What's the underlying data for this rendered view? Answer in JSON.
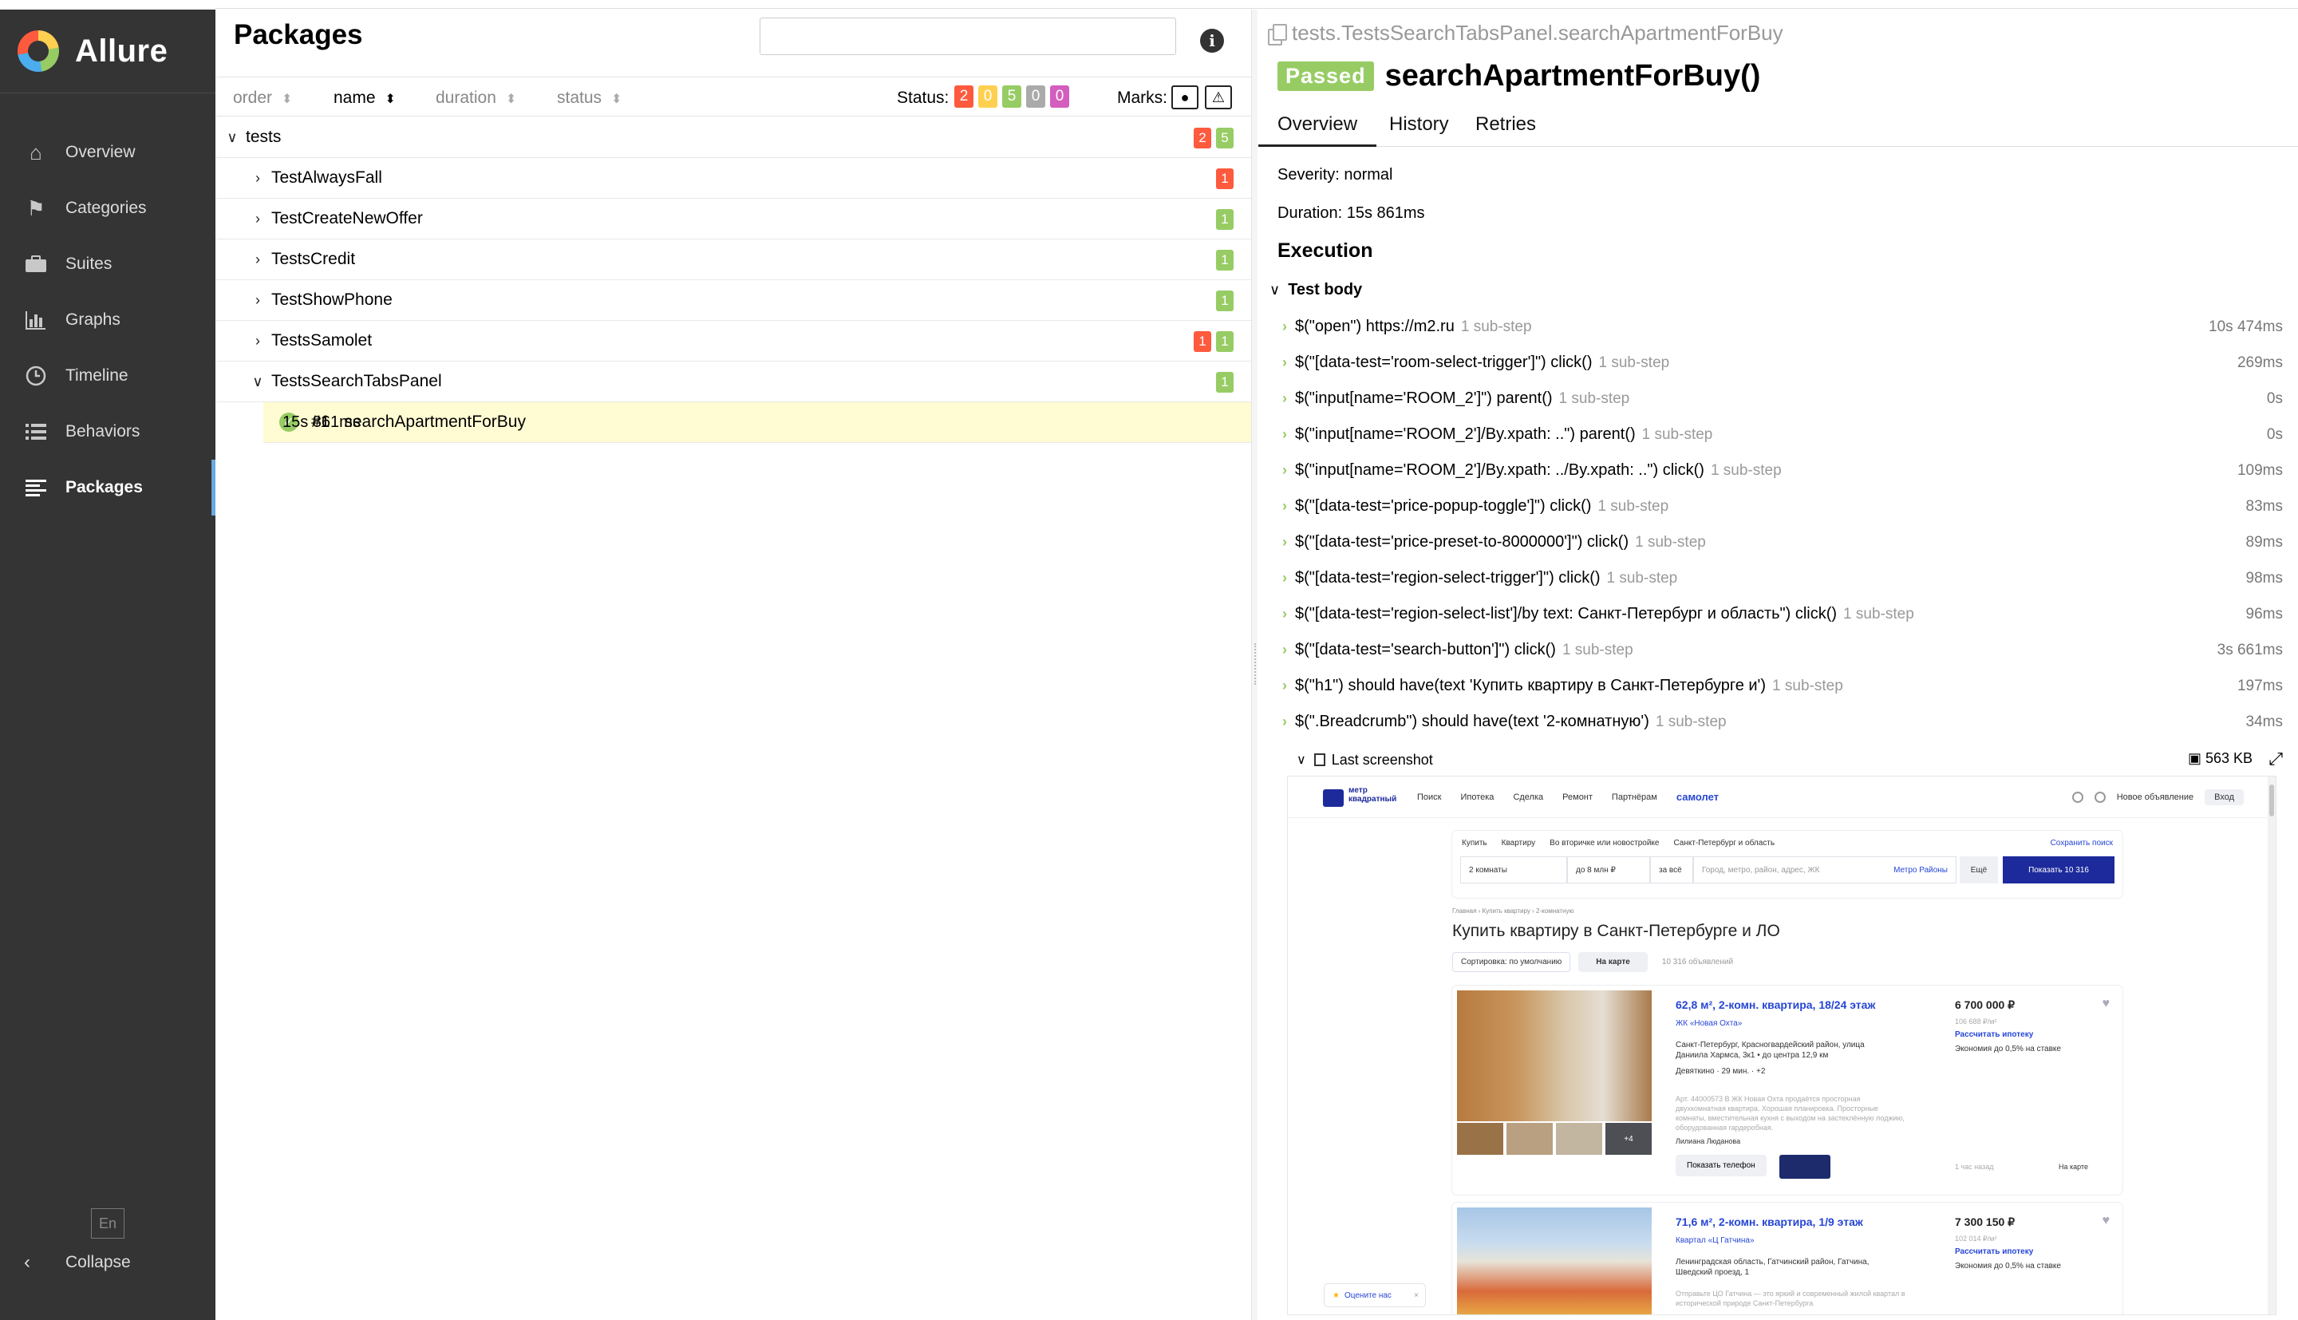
{
  "app": {
    "name": "Allure"
  },
  "sidebar": {
    "items": [
      {
        "label": "Overview",
        "icon": "home-icon"
      },
      {
        "label": "Categories",
        "icon": "flag-icon"
      },
      {
        "label": "Suites",
        "icon": "briefcase-icon"
      },
      {
        "label": "Graphs",
        "icon": "bar-chart-icon"
      },
      {
        "label": "Timeline",
        "icon": "clock-icon"
      },
      {
        "label": "Behaviors",
        "icon": "list-icon"
      },
      {
        "label": "Packages",
        "icon": "align-left-icon",
        "active": true
      }
    ],
    "language": "En",
    "collapse_label": "Collapse"
  },
  "left": {
    "title": "Packages",
    "search": {
      "value": "",
      "placeholder": ""
    },
    "sort": {
      "order": "order",
      "name": "name",
      "duration": "duration",
      "status": "status"
    },
    "status_label": "Status:",
    "status_counts": [
      "2",
      "0",
      "5",
      "0",
      "0"
    ],
    "marks_label": "Marks:",
    "tree": {
      "root": {
        "label": "tests",
        "failed": "2",
        "passed": "5"
      },
      "packages": [
        {
          "label": "TestAlwaysFall",
          "failed": "1"
        },
        {
          "label": "TestCreateNewOffer",
          "passed": "1"
        },
        {
          "label": "TestsCredit",
          "passed": "1"
        },
        {
          "label": "TestShowPhone",
          "passed": "1"
        },
        {
          "label": "TestsSamolet",
          "failed": "1",
          "passed": "1"
        },
        {
          "label": "TestsSearchTabsPanel",
          "passed": "1"
        }
      ],
      "leaf": {
        "num": "#1",
        "label": "searchApartmentForBuy",
        "duration": "15s 861ms"
      }
    }
  },
  "right": {
    "breadcrumb": "tests.TestsSearchTabsPanel.searchApartmentForBuy",
    "status": "Passed",
    "test_name": "searchApartmentForBuy()",
    "tabs": [
      "Overview",
      "History",
      "Retries"
    ],
    "severity": "Severity: normal",
    "duration": "Duration: 15s 861ms",
    "execution": "Execution",
    "test_body": "Test body",
    "steps": [
      {
        "text": "$(\"open\") https://m2.ru",
        "sub": "1 sub-step",
        "dur": "10s 474ms"
      },
      {
        "text": "$(\"[data-test='room-select-trigger']\") click()",
        "sub": "1 sub-step",
        "dur": "269ms"
      },
      {
        "text": "$(\"input[name='ROOM_2']\") parent()",
        "sub": "1 sub-step",
        "dur": "0s"
      },
      {
        "text": "$(\"input[name='ROOM_2']/By.xpath: ..\") parent()",
        "sub": "1 sub-step",
        "dur": "0s"
      },
      {
        "text": "$(\"input[name='ROOM_2']/By.xpath: ../By.xpath: ..\") click()",
        "sub": "1 sub-step",
        "dur": "109ms"
      },
      {
        "text": "$(\"[data-test='price-popup-toggle']\") click()",
        "sub": "1 sub-step",
        "dur": "83ms"
      },
      {
        "text": "$(\"[data-test='price-preset-to-8000000']\") click()",
        "sub": "1 sub-step",
        "dur": "89ms"
      },
      {
        "text": "$(\"[data-test='region-select-trigger']\") click()",
        "sub": "1 sub-step",
        "dur": "98ms"
      },
      {
        "text": "$(\"[data-test='region-select-list']/by text: Санкт-Петербург и область\") click()",
        "sub": "1 sub-step",
        "dur": "96ms"
      },
      {
        "text": "$(\"[data-test='search-button']\") click()",
        "sub": "1 sub-step",
        "dur": "3s 661ms"
      },
      {
        "text": "$(\"h1\") should have(text 'Купить квартиру в Санкт-Петербурге и')",
        "sub": "1 sub-step",
        "dur": "197ms"
      },
      {
        "text": "$(\".Breadcrumb\") should have(text '2-комнатную')",
        "sub": "1 sub-step",
        "dur": "34ms"
      }
    ],
    "attachment": {
      "label": "Last screenshot",
      "size": "563 KB"
    }
  },
  "screenshot": {
    "logo": "метр квадратный",
    "nav": [
      "Поиск",
      "Ипотека",
      "Сделка",
      "Ремонт",
      "Партнёрам"
    ],
    "brand": "самолет",
    "new_ad": "Новое объявление",
    "login": "Вход",
    "filters_top": [
      "Купить",
      "Квартиру",
      "Во вторичке или новостройке",
      "Санкт-Петербург и область"
    ],
    "save_search": "Сохранить поиск",
    "rooms": "2 комнаты",
    "price": "до 8 млн ₽",
    "per": "за всё",
    "city_placeholder": "Город, метро, район, адрес, ЖК",
    "metro": "Метро",
    "districts": "Районы",
    "more": "Ещё",
    "show": "Показать 10 316",
    "breadcrumb": "Главная › Купить квартиру › 2-комнатную",
    "h1": "Купить квартиру в Санкт-Петербурге и ЛО",
    "sort": "Сортировка: по умолчанию",
    "on_map": "На карте",
    "count": "10 316 объявлений",
    "card1": {
      "title": "62,8 м², 2-комн. квартира, 18/24 этаж",
      "complex": "ЖК «Новая Охта»",
      "address": "Санкт-Петербург, Красногвардейский район, улица Даниила Хармса, 3к1 • до центра 12,9 км",
      "metro": "Девяткино · 29 мин. · +2",
      "desc": "Арт. 44000573 В ЖК Новая Охта продаётся просторная двухкомнатная квартира. Хорошая планировка. Просторные комнаты, вместительная кухня с выходом на застеклённую лоджию, оборудованная гардеробная.",
      "agent": "Лилиана Люданова",
      "phone": "Показать телефон",
      "photos_more": "+4",
      "price": "6 700 000 ₽",
      "ppm": "106 688 ₽/м²",
      "mortgage": "Рассчитать ипотеку",
      "economy": "Экономия до 0,5% на ставке",
      "time": "1 час назад",
      "map": "На карте"
    },
    "card2": {
      "title": "71,6 м², 2-комн. квартира, 1/9 этаж",
      "complex": "Квартал «Ц Гатчина»",
      "address": "Ленинградская область, Гатчинский район, Гатчина, Шведский проезд, 1",
      "desc": "Отправьте ЦО Гатчина — это яркий и современный жилой квартал в исторической природе Санкт-Петербурга",
      "price": "7 300 150 ₽",
      "ppm": "102 014 ₽/м²",
      "mortgage": "Рассчитать ипотеку",
      "economy": "Экономия до 0,5% на ставке"
    },
    "rate_us": "Оцените нас"
  },
  "colors": {
    "passed": "#97cc64",
    "failed": "#fd5a3e",
    "broken": "#ffd050",
    "skipped": "#aaaaaa",
    "unknown": "#d35ebe",
    "sidebar": "#343434"
  }
}
